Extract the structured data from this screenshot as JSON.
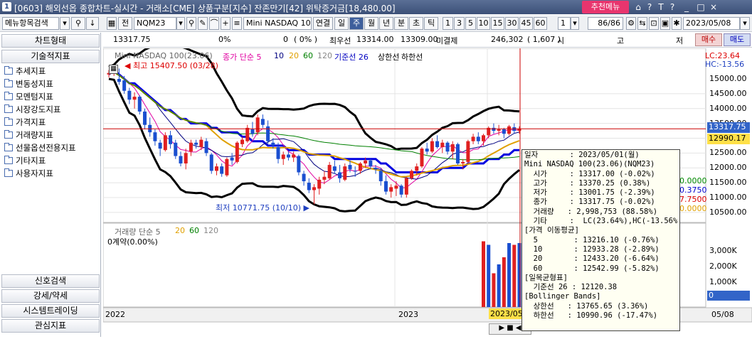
{
  "window": {
    "number": "1",
    "title": "[0603] 해외선옵 종합차트-실시간 - 거래소[CME] 상품구분[지수] 잔존만기[42] 위탁증거금[18,480.00]",
    "menu_button": "추천메뉴",
    "icons": [
      "home-icon",
      "help-icon",
      "text-size-icon",
      "dropdown-icon",
      "minimize-icon",
      "restore-icon",
      "close-icon"
    ]
  },
  "toolbar": {
    "menu_search": "메뉴항목검색",
    "search_icon": "search-icon",
    "symbol_btn": "전",
    "symbol": "NQM23",
    "product": "Mini NASDAQ 100(23.0",
    "continuous": "연결",
    "periods": [
      "일",
      "주",
      "월",
      "년",
      "분",
      "초",
      "틱"
    ],
    "selected_period": "주",
    "numbers": [
      "1",
      "3",
      "5",
      "10",
      "15",
      "30",
      "45",
      "60"
    ],
    "count_input": "1",
    "page": "86/86",
    "date": "2023/05/08"
  },
  "infobar": {
    "price": "13317.75",
    "pct": "0%",
    "change": "0",
    "change_pct": "( 0% )",
    "min_bid_label": "최우선",
    "bid": "13314.00",
    "ask": "13309.00",
    "open_int_label": "미결제",
    "open_int": "246,302",
    "open_int_change": "( 1,607 )",
    "col1": "시",
    "col2": "고",
    "col3": "저",
    "buy": "매수",
    "sell": "매도"
  },
  "sidebar": {
    "chart_type": "차트형태",
    "tech_indicator": "기술적지표",
    "tree": [
      "추세지표",
      "변동성지표",
      "모멘텀지표",
      "시장강도지표",
      "가격지표",
      "거래량지표",
      "선물옵션전용지표",
      "기타지표",
      "사용자지표"
    ],
    "bottom": [
      "신호검색",
      "강세/약세",
      "시스템트레이딩",
      "관심지표"
    ]
  },
  "chart": {
    "legend_name": "Mini NASDAQ 100(23.06)",
    "legend_ma": "종가 단순 5",
    "ma_periods": [
      "10",
      "20",
      "60",
      "120"
    ],
    "ma_colors": [
      "#e000a0",
      "#000080",
      "#e0a000",
      "#008000",
      "#888888"
    ],
    "legend_base": "기준선 26",
    "legend_upper": "상한선",
    "legend_lower": "하한선",
    "high_label": "최고 15407.50 (03/28)",
    "low_label": "최저 10771.75 (10/10)",
    "lc_hc": [
      "LC:23.64",
      "HC:-13.56"
    ],
    "y_ticks": [
      "15000.00",
      "14500.00",
      "14000.00",
      "13500.00",
      "12500.00",
      "12000.00",
      "11500.00",
      "11000.00",
      "10500.00"
    ],
    "current_price_tag": "13317.75",
    "second_tag": "12990.17",
    "right_partial": [
      "0.0000",
      "0.3750",
      "7.7500",
      "0.0000"
    ],
    "vol_legend": "거래량 단순 5",
    "vol_periods": [
      "20",
      "60",
      "120"
    ],
    "vol_sub": "0계약(0.00%)",
    "vol_ticks": [
      "3,000K",
      "2,000K",
      "1,000K"
    ],
    "vol_tag": "0",
    "x_labels": [
      "2022",
      "2023",
      "2023/05",
      "05/08"
    ]
  },
  "chart_data": {
    "type": "candlestick",
    "candles": [
      [
        15150,
        15300,
        15050,
        15200,
        1
      ],
      [
        15200,
        15407.5,
        15100,
        15250,
        1
      ],
      [
        15000,
        15350,
        14800,
        14900,
        0
      ],
      [
        14950,
        15100,
        14500,
        14600,
        0
      ],
      [
        14600,
        14700,
        14150,
        14300,
        0
      ],
      [
        14300,
        14550,
        14000,
        14400,
        1
      ],
      [
        14400,
        14450,
        13800,
        13900,
        0
      ],
      [
        13900,
        14000,
        13300,
        13450,
        0
      ],
      [
        13450,
        13700,
        13050,
        13200,
        0
      ],
      [
        13200,
        13300,
        12750,
        12900,
        0
      ],
      [
        12850,
        12950,
        12400,
        12650,
        0
      ],
      [
        12600,
        13200,
        12550,
        13100,
        1
      ],
      [
        13100,
        13250,
        12650,
        12800,
        0
      ],
      [
        12850,
        12950,
        12300,
        12400,
        0
      ],
      [
        12400,
        12550,
        12050,
        12150,
        0
      ],
      [
        12150,
        12650,
        11950,
        12500,
        1
      ],
      [
        12550,
        12950,
        12400,
        12850,
        1
      ],
      [
        12850,
        12950,
        12650,
        12780,
        0
      ],
      [
        12700,
        13050,
        12600,
        12950,
        1
      ],
      [
        12900,
        13000,
        12400,
        12500,
        0
      ],
      [
        12450,
        12500,
        11800,
        11900,
        0
      ],
      [
        11900,
        12150,
        11750,
        12050,
        1
      ],
      [
        12050,
        12150,
        11700,
        11800,
        0
      ],
      [
        11750,
        12350,
        11700,
        12300,
        1
      ],
      [
        12350,
        12500,
        12100,
        12250,
        0
      ],
      [
        12200,
        12900,
        12150,
        12850,
        1
      ],
      [
        12800,
        13050,
        12700,
        12950,
        1
      ],
      [
        12900,
        13450,
        12850,
        13350,
        1
      ],
      [
        13300,
        13550,
        13050,
        13150,
        0
      ],
      [
        13200,
        13800,
        13100,
        13700,
        1
      ],
      [
        13650,
        13800,
        13350,
        13450,
        0
      ],
      [
        13400,
        13600,
        12800,
        12900,
        0
      ],
      [
        12850,
        13000,
        12650,
        12750,
        0
      ],
      [
        12700,
        12850,
        12150,
        12300,
        0
      ],
      [
        12300,
        12550,
        12100,
        12450,
        1
      ],
      [
        12450,
        12550,
        12250,
        12350,
        0
      ],
      [
        12350,
        12550,
        12200,
        12450,
        1
      ],
      [
        12400,
        12450,
        11750,
        11850,
        0
      ],
      [
        11800,
        11900,
        11400,
        11550,
        0
      ],
      [
        11500,
        11650,
        11150,
        11250,
        0
      ],
      [
        11250,
        11450,
        10772,
        11350,
        1
      ],
      [
        11300,
        11700,
        11100,
        11600,
        1
      ],
      [
        11600,
        11900,
        11450,
        11700,
        1
      ],
      [
        11650,
        12200,
        11600,
        12100,
        1
      ],
      [
        12050,
        12250,
        11800,
        11900,
        0
      ],
      [
        11850,
        12100,
        11500,
        11650,
        0
      ],
      [
        11600,
        12150,
        11550,
        12050,
        1
      ],
      [
        12100,
        12250,
        11850,
        11950,
        0
      ],
      [
        11900,
        12050,
        11700,
        11900,
        0
      ],
      [
        11900,
        12200,
        11800,
        12150,
        1
      ],
      [
        12150,
        12350,
        12000,
        12250,
        1
      ],
      [
        12250,
        12300,
        11950,
        12050,
        0
      ],
      [
        12000,
        12100,
        11800,
        11950,
        0
      ],
      [
        11900,
        12000,
        11400,
        11550,
        0
      ],
      [
        11550,
        11750,
        11100,
        11200,
        0
      ],
      [
        11200,
        11450,
        11000,
        11350,
        1
      ],
      [
        11300,
        11550,
        11050,
        11400,
        1
      ],
      [
        11400,
        11450,
        11000,
        11100,
        0
      ],
      [
        11100,
        11700,
        11000,
        11650,
        1
      ],
      [
        11650,
        11950,
        11600,
        11900,
        1
      ],
      [
        11900,
        12150,
        11750,
        12050,
        1
      ],
      [
        12050,
        12700,
        12000,
        12650,
        1
      ],
      [
        12650,
        12850,
        12450,
        12550,
        0
      ],
      [
        12550,
        13000,
        12500,
        12900,
        1
      ],
      [
        12900,
        13100,
        12650,
        12700,
        0
      ],
      [
        12700,
        12950,
        12500,
        12850,
        1
      ],
      [
        12850,
        12900,
        12450,
        12550,
        0
      ],
      [
        12550,
        12900,
        12300,
        12800,
        1
      ],
      [
        12800,
        12850,
        12100,
        12150,
        0
      ],
      [
        12150,
        12300,
        11950,
        12200,
        1
      ],
      [
        12200,
        12950,
        12150,
        12900,
        1
      ],
      [
        12900,
        13150,
        12800,
        13050,
        1
      ],
      [
        13050,
        13200,
        12800,
        12900,
        0
      ],
      [
        12900,
        13150,
        12750,
        13100,
        1
      ],
      [
        13100,
        13400,
        13000,
        13350,
        1
      ],
      [
        13350,
        13500,
        13150,
        13250,
        0
      ],
      [
        13250,
        13450,
        13100,
        13300,
        1
      ],
      [
        13300,
        13350,
        13000,
        13150,
        0
      ],
      [
        13150,
        13450,
        13100,
        13400,
        1
      ],
      [
        13370,
        13500,
        13150,
        13250,
        0
      ],
      [
        13250,
        13400,
        13150,
        13317.75,
        1
      ]
    ],
    "volume": [
      {
        "i": 73,
        "v": 3700
      },
      {
        "i": 74,
        "v": 3500
      },
      {
        "i": 75,
        "v": 1900
      },
      {
        "i": 76,
        "v": 2400
      },
      {
        "i": 77,
        "v": 2800
      },
      {
        "i": 78,
        "v": 3600
      },
      {
        "i": 79,
        "v": 3500
      },
      {
        "i": 80,
        "v": 3600
      }
    ],
    "ylim": [
      10400,
      15600
    ],
    "vol_ylim": [
      0,
      4000
    ]
  },
  "tooltip": [
    "일자       : 2023/05/01(월)",
    "Mini NASDAQ 100(23.06)(NQM23)",
    "  시가     : 13317.00 (-0.02%)",
    "  고가     : 13370.25 (0.38%)",
    "  저가     : 13001.75 (-2.39%)",
    "  종가     : 13317.75 (-0.02%)",
    "  거래량   : 2,998,753 (88.58%)",
    "  기타     :  LC(23.64%),HC(-13.56%)",
    "[가격 이동평균]",
    "  5        : 13216.10 (-0.76%)",
    "  10       : 12933.28 (-2.89%)",
    "  20       : 12433.20 (-6.64%)",
    "  60       : 12542.99 (-5.82%)",
    "[일목균형표]",
    "  기준선 26 : 12120.38",
    "[Bollinger Bands]",
    "  상한선   : 13765.65 (3.36%)",
    "  하한선   : 10990.96 (-17.47%)"
  ]
}
